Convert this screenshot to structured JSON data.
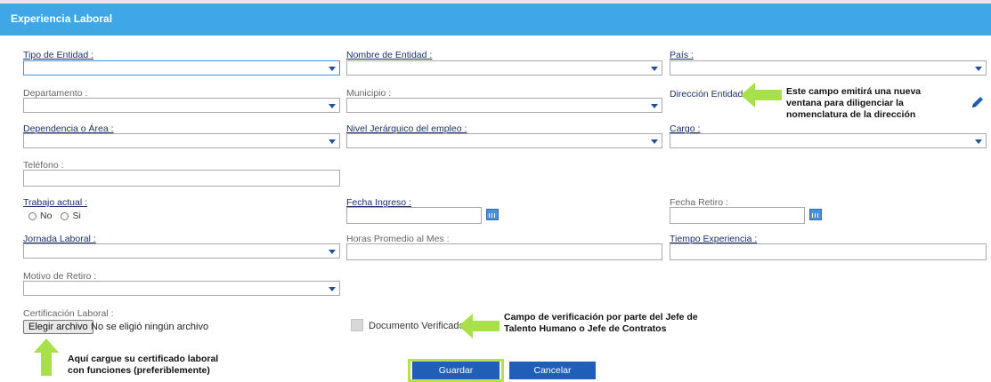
{
  "header": {
    "title": "Experiencia Laboral"
  },
  "fields": {
    "tipo_entidad": "Tipo de Entidad :",
    "nombre_entidad": "Nombre de Entidad :",
    "pais": "País :",
    "departamento": "Departamento :",
    "municipio": "Municipio :",
    "direccion_entidad": "Dirección Entidad :",
    "dependencia": "Dependencia o Área :",
    "nivel_jerarquico": "Nivel Jerárquico del empleo :",
    "cargo": "Cargo :",
    "telefono": "Teléfono :",
    "trabajo_actual": "Trabajo actual :",
    "fecha_ingreso": "Fecha Ingreso :",
    "fecha_retiro": "Fecha Retiro :",
    "jornada_laboral": "Jornada Laboral :",
    "horas_promedio": "Horas Promedio al Mes :",
    "tiempo_experiencia": "Tiempo Experiencia :",
    "motivo_retiro": "Motivo de Retiro :",
    "certificacion_laboral": "Certificación Laboral :"
  },
  "radio": {
    "no": "No",
    "si": "Si"
  },
  "file": {
    "button": "Elegir archivo",
    "status": "No se eligió ningún archivo"
  },
  "checkbox": {
    "label": "Documento Verificado"
  },
  "notes": {
    "direccion_line1": "Este campo emitirá una nueva",
    "direccion_line2": "ventana para diligenciar la",
    "direccion_line3": "nomenclatura de la dirección",
    "verificacion_line1": "Campo de verificación por parte del Jefe de",
    "verificacion_line2": "Talento Humano o Jefe de Contratos",
    "certificado_line1": "Aquí cargue su certificado laboral",
    "certificado_line2": "con funciones (preferiblemente)"
  },
  "buttons": {
    "save": "Guardar",
    "cancel": "Cancelar"
  },
  "colors": {
    "header": "#3fa7e6",
    "button": "#1f5fb8",
    "arrow": "#a8e04a",
    "label": "#1a2f6b"
  },
  "icons": {
    "edit": "pencil-icon",
    "calendar": "calendar-icon",
    "arrow": "arrow-left-icon"
  }
}
